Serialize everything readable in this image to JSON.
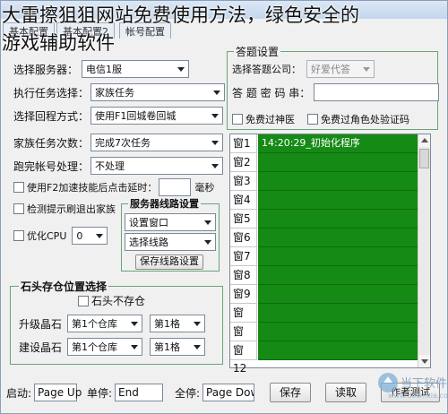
{
  "overlay": {
    "title_line1": "大雷擦狙狙网站免费使用方法，绿色安全的",
    "title_line2": "游戏辅助软件"
  },
  "window": {
    "title": ""
  },
  "tabs": [
    "基本配置",
    "基本配置2",
    "帐号配置"
  ],
  "left": {
    "server_label": "选择服务器：",
    "server_value": "电信1服",
    "exec_task_label": "执行任务选择：",
    "exec_task_value": "家族任务",
    "return_label": "选择回程方式：",
    "return_value": "使用F1回城卷回城",
    "count_label": "家族任务次数：",
    "count_value": "完成7次任务",
    "after_label": "跑完帐号处理：",
    "after_value": "不处理",
    "f2_label": "使用F2加速技能后点击延时：",
    "f2_unit": "毫秒",
    "detect_label": "检测提示刷退出家族",
    "cpu_label": "优化CPU",
    "cpu_value": "0"
  },
  "server_group": {
    "title": "服务器线路设置",
    "window_value": "设置窗口",
    "line_value": "选择线路",
    "save_button": "保存线路设置"
  },
  "stone_group": {
    "title": "石头存仓位置选择",
    "no_store_label": "石头不存仓",
    "upgrade_label": "升级晶石",
    "upgrade_store": "第1个仓库",
    "upgrade_slot": "第1格",
    "build_label": "建设晶石",
    "build_store": "第1个仓库",
    "build_slot": "第1格"
  },
  "answer_group": {
    "title": "答题设置",
    "company_label": "选择答题公司：",
    "company_value": "好爱代答",
    "password_label": "答 题 密 码 串：",
    "pass_medic_label": "免费过神医",
    "pass_captcha_label": "免费过角色处验证码"
  },
  "slots": {
    "labels": [
      "窗1",
      "窗2",
      "窗3",
      "窗4",
      "窗5",
      "窗6",
      "窗7",
      "窗8",
      "窗9",
      "窗10",
      "窗11",
      "窗12"
    ],
    "first_status": "14:20:29_初始化程序"
  },
  "bottom": {
    "start_label": "启动:",
    "start_value": "Page Up",
    "pause_label": "单停:",
    "pause_value": "End",
    "all_stop_label": "全停:",
    "all_stop_value": "Page Dow",
    "save_button": "保存",
    "read_button": "读取",
    "extra_button": "作者测试"
  },
  "watermark": {
    "text": "当下软件园",
    "sub": "www.downxia.com"
  },
  "colors": {
    "slot_green": "#158a15",
    "group_border": "#6aa27a"
  }
}
